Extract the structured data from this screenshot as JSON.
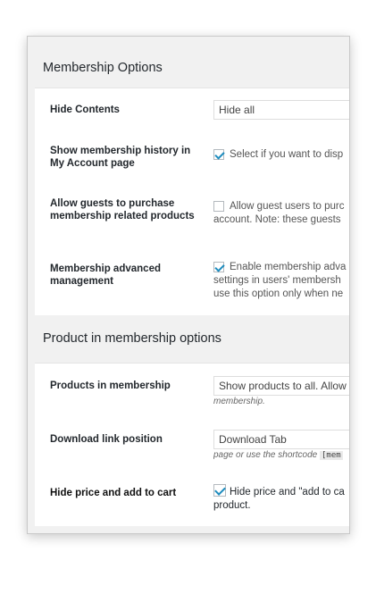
{
  "sections": [
    {
      "title": "Membership Options",
      "rows": [
        {
          "label": "Hide Contents",
          "control": "select",
          "value": "Hide all"
        },
        {
          "label": "Show membership history in My Account page",
          "control": "checkbox",
          "checked": true,
          "text_lines": [
            "Select if you want to disp"
          ]
        },
        {
          "label": "Allow guests to purchase membership related products",
          "control": "checkbox",
          "checked": false,
          "text_lines": [
            "Allow guest users to purc",
            "account. Note: these guests"
          ]
        },
        {
          "label": "Membership advanced management",
          "control": "checkbox",
          "checked": true,
          "text_lines": [
            "Enable membership adva",
            "settings in users' membersh",
            "use this option only when ne"
          ]
        }
      ]
    },
    {
      "title": "Product in membership options",
      "rows": [
        {
          "label": "Products in membership",
          "control": "select",
          "value": "Show products to all. Allow",
          "note": "membership."
        },
        {
          "label": "Download link position",
          "control": "select",
          "value": "Download Tab",
          "note": "page or use the shortcode",
          "note_code": "[mem"
        },
        {
          "label": "Hide price and add to cart",
          "control": "checkbox",
          "checked": true,
          "text_lines": [
            "Hide price and \"add to ca",
            "product."
          ]
        }
      ]
    }
  ],
  "colors": {
    "accent": "#1e8cbe",
    "panel_bg": "#ffffff",
    "frame_bg": "#f1f1f1"
  }
}
